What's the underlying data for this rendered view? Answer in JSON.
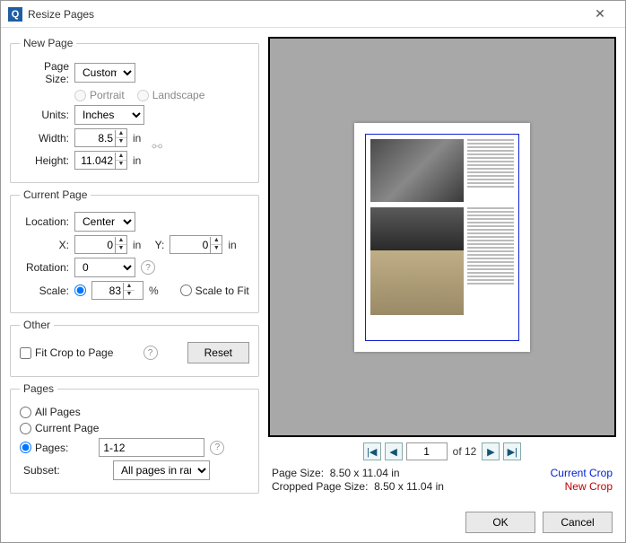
{
  "window": {
    "title": "Resize Pages"
  },
  "newPage": {
    "legend": "New Page",
    "pageSizeLabel": "Page Size:",
    "pageSizeValue": "Custom",
    "portrait": "Portrait",
    "landscape": "Landscape",
    "unitsLabel": "Units:",
    "unitsValue": "Inches",
    "widthLabel": "Width:",
    "widthValue": "8.5",
    "heightLabel": "Height:",
    "heightValue": "11.042",
    "unitSuffix": "in"
  },
  "currentPage": {
    "legend": "Current Page",
    "locationLabel": "Location:",
    "locationValue": "Center",
    "xLabel": "X:",
    "xValue": "0",
    "yLabel": "Y:",
    "yValue": "0",
    "unitSuffix": "in",
    "rotationLabel": "Rotation:",
    "rotationValue": "0",
    "scaleLabel": "Scale:",
    "scaleValue": "83",
    "scalePct": "%",
    "scaleToFit": "Scale to Fit"
  },
  "other": {
    "legend": "Other",
    "fitCrop": "Fit Crop to Page",
    "reset": "Reset"
  },
  "pages": {
    "legend": "Pages",
    "all": "All Pages",
    "current": "Current Page",
    "pagesLabel": "Pages:",
    "rangeValue": "1-12",
    "subsetLabel": "Subset:",
    "subsetValue": "All pages in range"
  },
  "pager": {
    "current": "1",
    "ofText": "of 12"
  },
  "meta": {
    "pageSizeLabel": "Page Size:",
    "pageSizeValue": "8.50 x 11.04 in",
    "croppedLabel": "Cropped Page Size:",
    "croppedValue": "8.50 x 11.04 in",
    "currentCrop": "Current Crop",
    "newCrop": "New Crop"
  },
  "footer": {
    "ok": "OK",
    "cancel": "Cancel"
  }
}
